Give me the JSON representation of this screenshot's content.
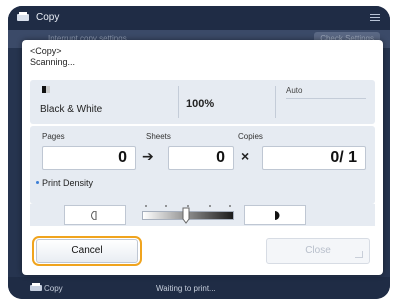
{
  "topbar": {
    "title": "Copy"
  },
  "background": {
    "left_text": "Interrupt copy settings",
    "right_button": "Check Settings"
  },
  "dialog": {
    "header_line1": "<Copy>",
    "header_line2": "Scanning...",
    "color_mode": "Black & White",
    "ratio": "100%",
    "paper": "Auto",
    "pages_label": "Pages",
    "sheets_label": "Sheets",
    "copies_label": "Copies",
    "pages_value": "0",
    "sheets_value": "0",
    "copies_value": "0/ 1",
    "arrow": "➔",
    "times": "×",
    "density_label": "Print Density",
    "density_level": 0.5,
    "cancel_label": "Cancel",
    "close_label": "Close"
  },
  "bottombar": {
    "label": "Copy",
    "status": "Waiting to print..."
  },
  "colors": {
    "accent_focus": "#f0a41e",
    "panel": "#e6ebf2",
    "chrome": "#26344f",
    "bullet": "#3d7fd6"
  }
}
